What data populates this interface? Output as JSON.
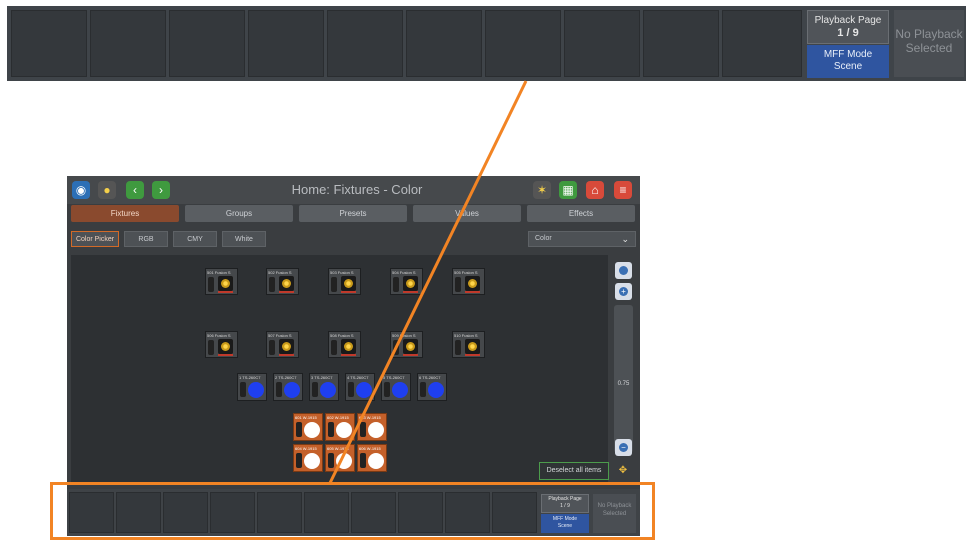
{
  "top_bar": {
    "playback_page_label": "Playback Page",
    "playback_page_value": "1 / 9",
    "mff_mode_label": "MFF Mode",
    "mff_mode_value": "Scene",
    "no_playback_text": "No Playback Selected"
  },
  "app": {
    "title": "Home: Fixtures - Color",
    "header_icons": [
      "eye-icon",
      "lightbulb-icon",
      "back-arrow-icon",
      "forward-arrow-icon",
      "sparkle-icon",
      "grid-icon",
      "home-icon",
      "menu-icon"
    ],
    "tabs": [
      "Fixtures",
      "Groups",
      "Presets",
      "Values",
      "Effects"
    ],
    "active_tab": "Fixtures",
    "subtabs": [
      "Color Picker",
      "RGB",
      "CMY",
      "White"
    ],
    "active_subtab": "Color Picker",
    "color_dropdown": "Color",
    "zoom_value": "0.75",
    "deselect_label": "Deselect all items",
    "accent_color": "#f28424"
  },
  "fixtures": {
    "row1": [
      "501 Fusion S",
      "502 Fusion S",
      "503 Fusion S",
      "504 Fusion S",
      "505 Fusion S"
    ],
    "row2": [
      "506 Fusion S",
      "507 Fusion S",
      "508 Fusion S",
      "509 Fusion S",
      "510 Fusion S"
    ],
    "row3": [
      "1 TS-260C7",
      "2 TS-260C7",
      "3 TS-260C7",
      "4 TS-260C7",
      "5 TS-260C7",
      "6 TS-260C7"
    ],
    "selected_row1": [
      "601 W-1915",
      "602 W-1915",
      "603 W-1915"
    ],
    "selected_row2": [
      "604 W-1915",
      "605 W-1915",
      "606 W-1915"
    ]
  },
  "bottom_bar": {
    "playback_page_label": "Playback Page",
    "playback_page_value": "1 / 9",
    "mff_mode_label": "MFF Mode",
    "mff_mode_value": "Scene",
    "no_playback_text": "No Playback Selected"
  }
}
